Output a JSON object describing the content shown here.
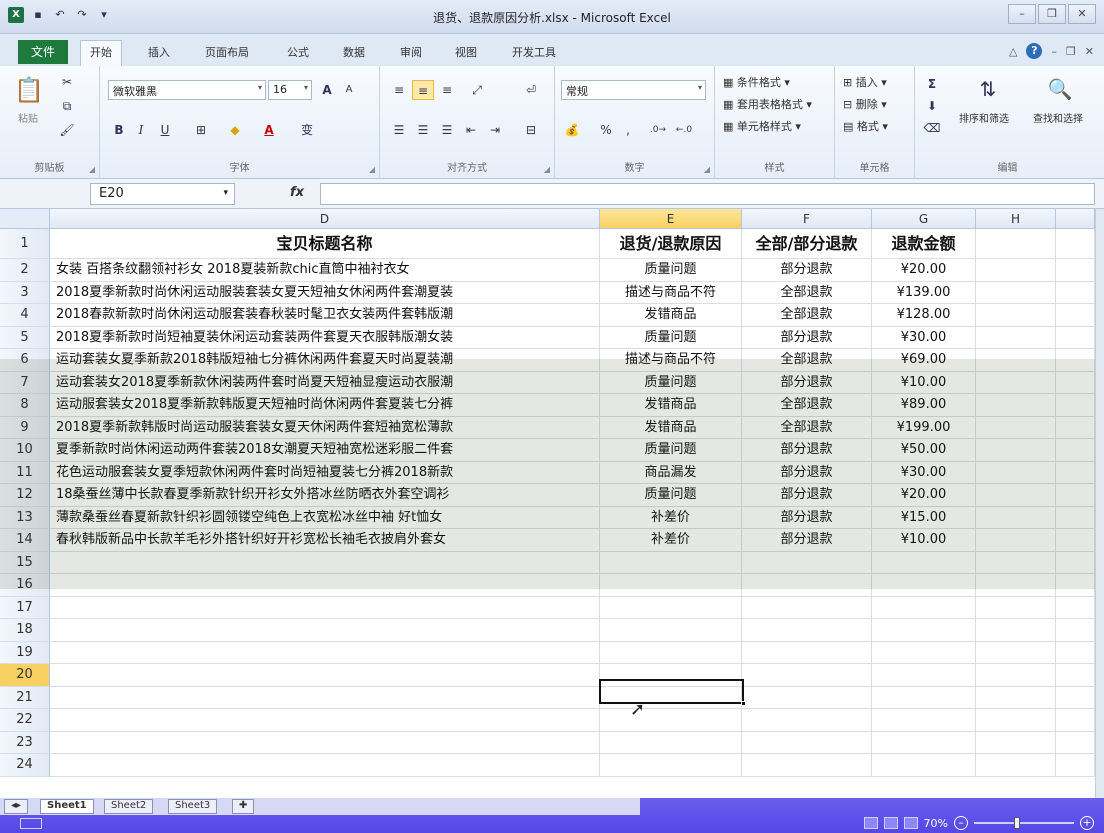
{
  "window": {
    "title": "退货、退款原因分析.xlsx - Microsoft Excel",
    "app_icon": "X",
    "controls": [
      "minimize-icon",
      "restore-icon",
      "close-icon"
    ]
  },
  "ribbon_tabs": [
    "文件",
    "开始",
    "插入",
    "页面布局",
    "公式",
    "数据",
    "审阅",
    "视图",
    "开发工具"
  ],
  "active_tab": "开始",
  "groups": {
    "clipboard": {
      "label": "剪贴板",
      "paste": "粘贴"
    },
    "font": {
      "label": "字体",
      "font_name": "微软雅黑",
      "font_size": "16",
      "bold": "B",
      "italic": "I",
      "underline": "U",
      "grow": "A",
      "shrink": "A",
      "phonetic": "变"
    },
    "alignment": {
      "label": "对齐方式"
    },
    "number": {
      "label": "数字",
      "format": "常规",
      "percent": "%",
      "comma": ","
    },
    "styles": {
      "label": "样式",
      "conditional": "条件格式",
      "table": "套用表格格式",
      "cell_styles": "单元格样式"
    },
    "cells": {
      "label": "单元格",
      "insert": "插入",
      "delete": "删除",
      "format": "格式"
    },
    "editing": {
      "label": "编辑",
      "sum": "Σ",
      "sort": "排序和筛选",
      "find": "查找和选择"
    }
  },
  "formula_bar": {
    "name_box": "E20",
    "fx": "fx",
    "formula": ""
  },
  "columns": [
    {
      "id": "D",
      "selected": false
    },
    {
      "id": "E",
      "selected": true
    },
    {
      "id": "F",
      "selected": false
    },
    {
      "id": "G",
      "selected": false
    },
    {
      "id": "H",
      "selected": false
    }
  ],
  "header_row": [
    "宝贝标题名称",
    "退货/退款原因",
    "全部/部分退款",
    "退款金额"
  ],
  "rows": [
    [
      "女装 百搭条纹翻领衬衫女 2018夏装新款chic直筒中袖衬衣女",
      "质量问题",
      "部分退款",
      "¥20.00"
    ],
    [
      "2018夏季新款时尚休闲运动服装套装女夏天短袖女休闲两件套潮夏装",
      "描述与商品不符",
      "全部退款",
      "¥139.00"
    ],
    [
      "2018春款新款时尚休闲运动服套装春秋装时髦卫衣女装两件套韩版潮",
      "发错商品",
      "全部退款",
      "¥128.00"
    ],
    [
      "2018夏季新款时尚短袖夏装休闲运动套装两件套夏天衣服韩版潮女装",
      "质量问题",
      "部分退款",
      "¥30.00"
    ],
    [
      "运动套装女夏季新款2018韩版短袖七分裤休闲两件套夏天时尚夏装潮",
      "描述与商品不符",
      "全部退款",
      "¥69.00"
    ],
    [
      "运动套装女2018夏季新款休闲装两件套时尚夏天短袖显瘦运动衣服潮",
      "质量问题",
      "部分退款",
      "¥10.00"
    ],
    [
      "运动服套装女2018夏季新款韩版夏天短袖时尚休闲两件套夏装七分裤",
      "发错商品",
      "全部退款",
      "¥89.00"
    ],
    [
      "2018夏季新款韩版时尚运动服装套装女夏天休闲两件套短袖宽松薄款",
      "发错商品",
      "全部退款",
      "¥199.00"
    ],
    [
      "夏季新款时尚休闲运动两件套装2018女潮夏天短袖宽松迷彩服二件套",
      "质量问题",
      "部分退款",
      "¥50.00"
    ],
    [
      "花色运动服套装女夏季短款休闲两件套时尚短袖夏装七分裤2018新款",
      "商品漏发",
      "部分退款",
      "¥30.00"
    ],
    [
      "18桑蚕丝薄中长款春夏季新款针织开衫女外搭冰丝防晒衣外套空调衫",
      "质量问题",
      "部分退款",
      "¥20.00"
    ],
    [
      "薄款桑蚕丝春夏新款针织衫圆领镂空纯色上衣宽松冰丝中袖 好t恤女",
      "补差价",
      "部分退款",
      "¥15.00"
    ],
    [
      "春秋韩版新品中长款羊毛衫外搭针织好开衫宽松长袖毛衣披肩外套女",
      "补差价",
      "部分退款",
      "¥10.00"
    ]
  ],
  "row_numbers": [
    "1",
    "2",
    "3",
    "4",
    "5",
    "6",
    "7",
    "8",
    "9",
    "10",
    "11",
    "12",
    "13",
    "14",
    "15",
    "16",
    "17",
    "18",
    "19",
    "20",
    "21",
    "22",
    "23",
    "24"
  ],
  "selected_row": "20",
  "sheet_tabs": [
    "Sheet1",
    "Sheet2",
    "Sheet3"
  ],
  "active_sheet": "Sheet1",
  "status": {
    "zoom": "70%"
  }
}
